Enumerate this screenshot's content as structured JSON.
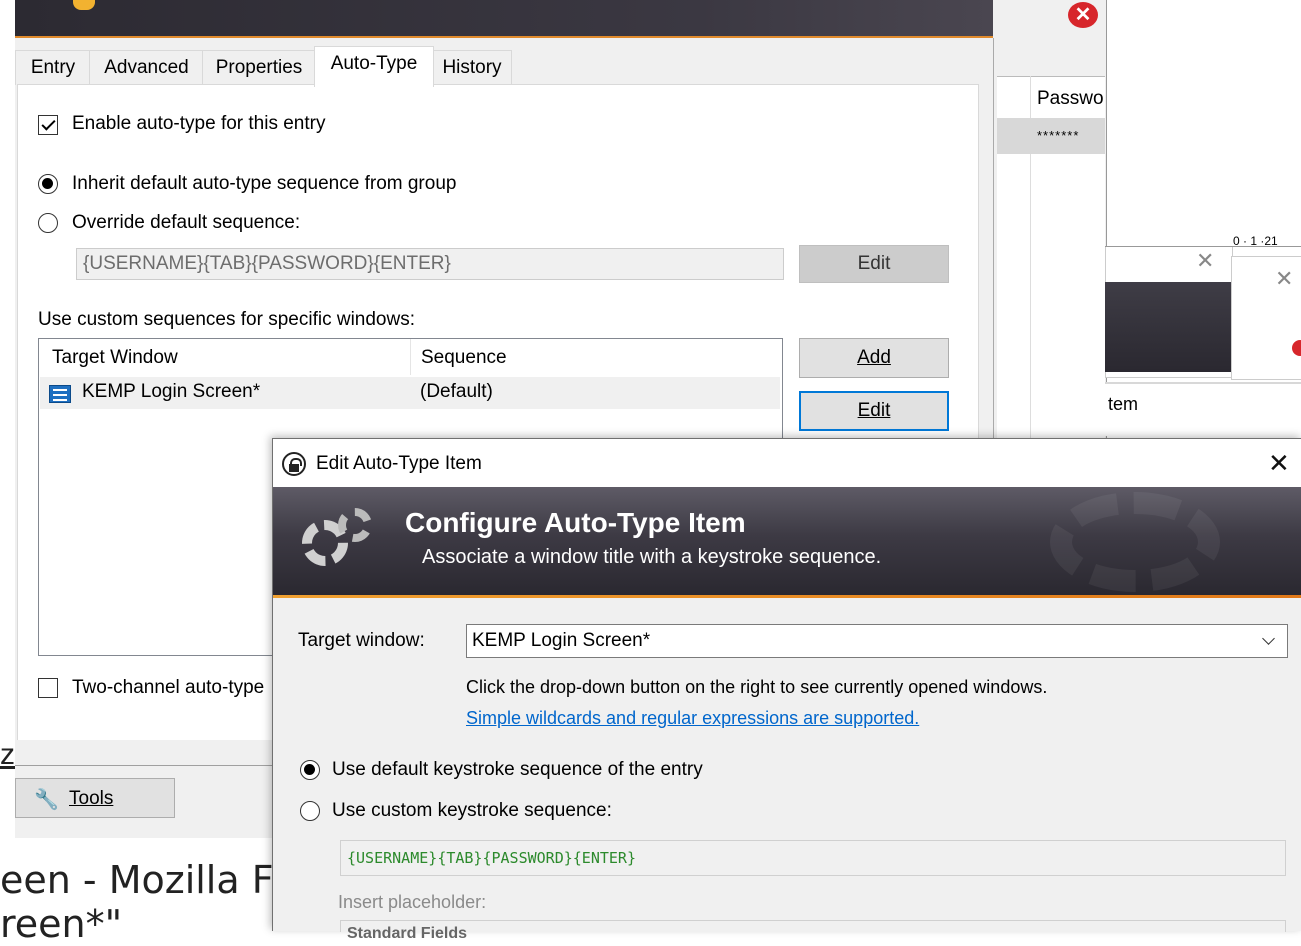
{
  "background": {
    "bottom_text_line1": "een - Mozilla F",
    "bottom_text_line2": "reen*\"",
    "stray_z": "z",
    "right_window": {
      "column_header": "Passwo",
      "password_mask": "*******",
      "ruler_text": "0 · 1 ·21",
      "item_text": "tem"
    }
  },
  "edit_entry_dialog": {
    "tabs": [
      "Entry",
      "Advanced",
      "Properties",
      "Auto-Type",
      "History"
    ],
    "active_tab": "Auto-Type",
    "enable_autotype_label": "Enable auto-type for this entry",
    "enable_autotype_checked": true,
    "inherit_radio_label": "Inherit default auto-type sequence from group",
    "override_radio_label": "Override default sequence:",
    "selected_radio": "inherit",
    "default_sequence_value": "{USERNAME}{TAB}{PASSWORD}{ENTER}",
    "edit_button_label": "Edit",
    "custom_sequences_label": "Use custom sequences for specific windows:",
    "list_columns": [
      "Target Window",
      "Sequence"
    ],
    "list_rows": [
      {
        "target_window": "KEMP Login Screen*",
        "sequence": "(Default)"
      }
    ],
    "add_button_label": "Add",
    "edit_item_button_label": "Edit",
    "two_channel_label": "Two-channel auto-type",
    "two_channel_checked": false,
    "tools_button_label": "Tools"
  },
  "autotype_item_dialog": {
    "window_title": "Edit Auto-Type Item",
    "banner_title": "Configure Auto-Type Item",
    "banner_subtitle": "Associate a window title with a keystroke sequence.",
    "target_window_label": "Target window:",
    "target_window_value": "KEMP Login Screen*",
    "dropdown_hint": "Click the drop-down button on the right to see currently opened windows.",
    "wildcards_link": "Simple wildcards and regular expressions are supported.",
    "use_default_label": "Use default keystroke sequence of the entry",
    "use_custom_label": "Use custom keystroke sequence:",
    "selected_option": "default",
    "custom_sequence_tokens": [
      "{USERNAME}",
      "{TAB}",
      "{PASSWORD}",
      "{ENTER}"
    ],
    "insert_placeholder_label": "Insert placeholder:",
    "placeholder_combo_value": "Standard Fields"
  },
  "colors": {
    "accent_orange": "#e08a2c",
    "link_blue": "#0066cc",
    "focus_blue": "#0078d7",
    "token_green": "#2c8a2c",
    "close_red": "#d7262b"
  }
}
